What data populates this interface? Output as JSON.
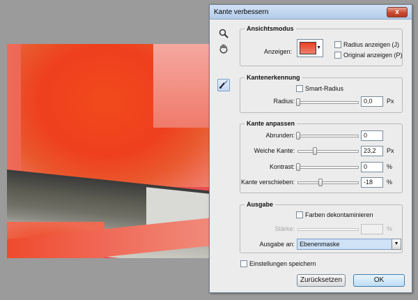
{
  "dialog": {
    "title": "Kante verbessern",
    "close_label": "x"
  },
  "tools": {
    "zoom_icon": "magnifier-icon",
    "hand_icon": "hand-icon",
    "brush_icon": "refine-radius-brush-icon"
  },
  "view_mode": {
    "legend": "Ansichtsmodus",
    "show_label": "Anzeigen:",
    "show_radius": "Radius anzeigen (J)",
    "show_original": "Original anzeigen (P)"
  },
  "edge_detection": {
    "legend": "Kantenerkennung",
    "smart_radius": "Smart-Radius",
    "radius_label": "Radius:",
    "radius_value": "0,0",
    "radius_unit": "Px",
    "radius_fraction": 0.0
  },
  "adjust_edge": {
    "legend": "Kante anpassen",
    "rows": [
      {
        "label": "Abrunden:",
        "value": "0",
        "unit": "",
        "fraction": 0.0
      },
      {
        "label": "Weiche Kante:",
        "value": "23,2",
        "unit": "Px",
        "fraction": 0.28
      },
      {
        "label": "Kontrast:",
        "value": "0",
        "unit": "%",
        "fraction": 0.0
      },
      {
        "label": "Kante verschieben:",
        "value": "-18",
        "unit": "%",
        "fraction": 0.38
      }
    ]
  },
  "output": {
    "legend": "Ausgabe",
    "decontaminate": "Farben dekontaminieren",
    "amount_label": "Stärke:",
    "amount_unit": "%",
    "output_to_label": "Ausgabe an:",
    "output_to_value": "Ebenenmaske"
  },
  "footer": {
    "remember": "Einstellungen speichern",
    "reset": "Zurücksetzen",
    "ok": "OK"
  }
}
